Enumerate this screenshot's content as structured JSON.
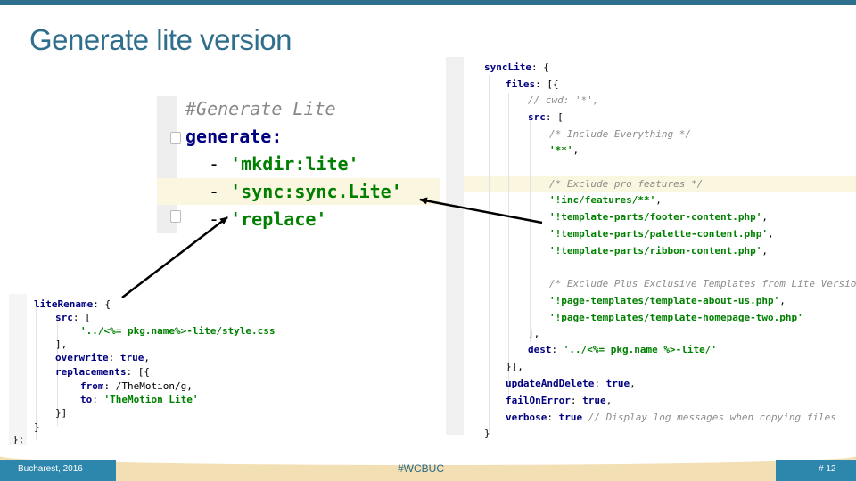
{
  "title": "Generate lite version",
  "yaml": {
    "lines": [
      {
        "text": "#Generate Lite"
      },
      {
        "text": "generate:"
      },
      {
        "dash": "- ",
        "value": "'mkdir:lite'"
      },
      {
        "dash": "- ",
        "value": "'sync:sync.Lite'"
      },
      {
        "dash": "- ",
        "value": "'replace'"
      }
    ]
  },
  "right_code": [
    [
      "k:syncLite",
      "p:: {"
    ],
    [
      "k:files",
      "p:: [{"
    ],
    [
      "c:// cwd: '*',"
    ],
    [
      "k:src",
      "p:: ["
    ],
    [
      "c:/* Include Everything */"
    ],
    [
      "s:'**'",
      "p:,"
    ],
    [
      "c:/* Exclude pro features */"
    ],
    [
      "s:'!inc/features/**'",
      "p:,"
    ],
    [
      "s:'!template-parts/footer-content.php'",
      "p:,"
    ],
    [
      "s:'!template-parts/palette-content.php'",
      "p:,"
    ],
    [
      "s:'!template-parts/ribbon-content.php'",
      "p:,"
    ],
    [
      "c:/* Exclude Plus Exclusive Templates from Lite Version*/"
    ],
    [
      "s:'!page-templates/template-about-us.php'",
      "p:,"
    ],
    [
      "s:'!page-templates/template-homepage-two.php'"
    ],
    [
      "p:],"
    ],
    [
      "k:dest",
      "p:: ",
      "s:'../<%= pkg.name %>-lite/'"
    ],
    [
      "p:}],"
    ],
    [
      "k:updateAndDelete",
      "p:: ",
      "k:true",
      "p:,"
    ],
    [
      "k:failOnError",
      "p:: ",
      "k:true",
      "p:,"
    ],
    [
      "k:verbose",
      "p:: ",
      "k:true",
      "c: // Display log messages when copying files"
    ],
    [
      "p:}"
    ]
  ],
  "left_code": [
    [
      "k:liteRename",
      "p:: {"
    ],
    [
      "k:src",
      "p:: ["
    ],
    [
      "s:'../<%= pkg.name%>-lite/style.css"
    ],
    [
      "p:],"
    ],
    [
      "k:overwrite",
      "p:: ",
      "k:true",
      "p:,"
    ],
    [
      "k:replacements",
      "p:: [{"
    ],
    [
      "k:from",
      "p:: /TheMotion/g,"
    ],
    [
      "k:to",
      "p:: ",
      "s:'TheMotion Lite'"
    ],
    [
      "p:}]"
    ],
    [
      "p:}"
    ],
    [
      "p:};"
    ]
  ],
  "footer": {
    "left": "Bucharest, 2016",
    "center": "#WCBUC",
    "right": "# 12"
  }
}
